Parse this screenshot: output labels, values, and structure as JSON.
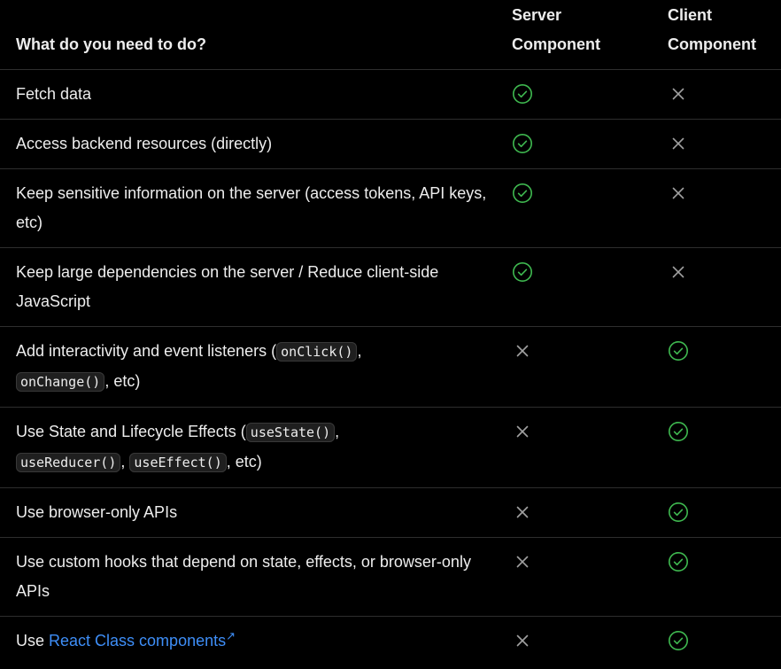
{
  "header": {
    "task": "What do you need to do?",
    "server_line1": "Server",
    "server_line2": "Component",
    "client_line1": "Client",
    "client_line2": "Component"
  },
  "rows": [
    {
      "text": "Fetch data"
    },
    {
      "text": "Access backend resources (directly)"
    },
    {
      "text": "Keep sensitive information on the server (access tokens, API keys, etc)"
    },
    {
      "text": "Keep large dependencies on the server / Reduce client-side JavaScript"
    },
    {
      "before": "Add interactivity and event listeners (",
      "code1": "onClick()",
      "mid": ",",
      "code2": "onChange()",
      "after": ", etc)"
    },
    {
      "before": "Use State and Lifecycle Effects (",
      "code1": "useState()",
      "mid1": ",",
      "code2": "useReducer()",
      "mid2": ",",
      "code3": "useEffect()",
      "after": ", etc)"
    },
    {
      "text": "Use browser-only APIs"
    },
    {
      "text": "Use custom hooks that depend on state, effects, or browser-only APIs"
    },
    {
      "before": "Use ",
      "link": "React Class components",
      "link_arrow": "↗"
    }
  ],
  "support": {
    "server": [
      "check",
      "check",
      "check",
      "check",
      "cross",
      "cross",
      "cross",
      "cross",
      "cross"
    ],
    "client": [
      "cross",
      "cross",
      "cross",
      "cross",
      "check",
      "check",
      "check",
      "check",
      "check"
    ]
  },
  "colors": {
    "check": "#3fb950",
    "cross": "#a1a1a1",
    "link": "#3e8ef7"
  }
}
